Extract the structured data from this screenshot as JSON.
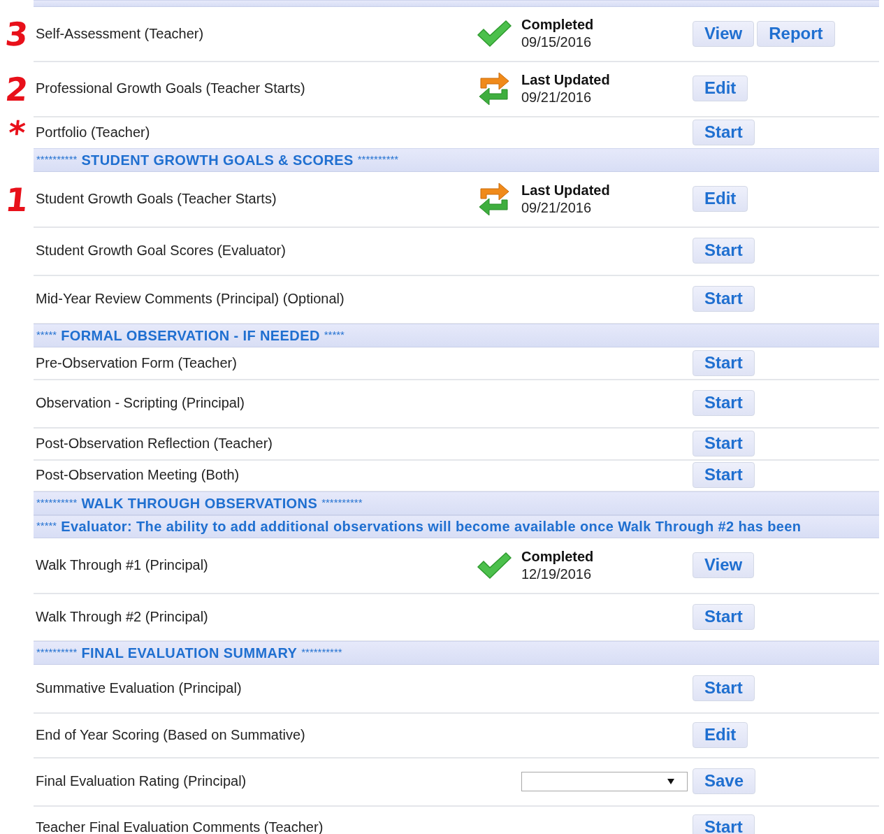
{
  "rows": [
    {
      "kind": "band"
    },
    {
      "kind": "task",
      "annotation": "3",
      "name": "Self-Assessment (Teacher)",
      "status": {
        "kind": "completed",
        "label": "Completed",
        "date": "09/15/2016"
      },
      "buttons": [
        "View",
        "Report"
      ]
    },
    {
      "kind": "task",
      "annotation": "2",
      "name": "Professional Growth Goals (Teacher Starts)",
      "status": {
        "kind": "updated",
        "label": "Last Updated",
        "date": "09/21/2016"
      },
      "buttons": [
        "Edit"
      ]
    },
    {
      "kind": "task",
      "annotation": "*",
      "name": "Portfolio (Teacher)",
      "buttons": [
        "Start"
      ]
    },
    {
      "kind": "section",
      "prefix": "**********",
      "title": "STUDENT GROWTH GOALS & SCORES",
      "suffix": "**********"
    },
    {
      "kind": "task",
      "annotation": "1",
      "name": "Student Growth Goals (Teacher Starts)",
      "status": {
        "kind": "updated",
        "label": "Last Updated",
        "date": "09/21/2016"
      },
      "buttons": [
        "Edit"
      ]
    },
    {
      "kind": "task",
      "name": "Student Growth Goal Scores (Evaluator)",
      "buttons": [
        "Start"
      ]
    },
    {
      "kind": "task",
      "name": "Mid-Year Review Comments (Principal) (Optional)",
      "buttons": [
        "Start"
      ]
    },
    {
      "kind": "section",
      "prefix": "*****",
      "title": "FORMAL OBSERVATION - IF NEEDED",
      "suffix": "*****"
    },
    {
      "kind": "task",
      "name": "Pre-Observation Form (Teacher)",
      "buttons": [
        "Start"
      ]
    },
    {
      "kind": "task",
      "name": "Observation - Scripting (Principal)",
      "buttons": [
        "Start"
      ]
    },
    {
      "kind": "task",
      "name": "Post-Observation Reflection (Teacher)",
      "buttons": [
        "Start"
      ]
    },
    {
      "kind": "task",
      "name": "Post-Observation Meeting (Both)",
      "buttons": [
        "Start"
      ]
    },
    {
      "kind": "section",
      "prefix": "**********",
      "title": "WALK THROUGH OBSERVATIONS",
      "suffix": "**********"
    },
    {
      "kind": "section",
      "prefix": "*****",
      "title": "Evaluator: The ability to add additional observations will become available once Walk Through #2 has been"
    },
    {
      "kind": "task",
      "name": "Walk Through #1 (Principal)",
      "status": {
        "kind": "completed",
        "label": "Completed",
        "date": "12/19/2016"
      },
      "buttons": [
        "View"
      ]
    },
    {
      "kind": "task",
      "name": "Walk Through #2 (Principal)",
      "buttons": [
        "Start"
      ]
    },
    {
      "kind": "section",
      "prefix": "**********",
      "title": "FINAL EVALUATION SUMMARY",
      "suffix": "**********"
    },
    {
      "kind": "task",
      "name": "Summative Evaluation (Principal)",
      "buttons": [
        "Start"
      ]
    },
    {
      "kind": "task",
      "name": "End of Year Scoring (Based on Summative)",
      "buttons": [
        "Edit"
      ]
    },
    {
      "kind": "select_task",
      "name": "Final Evaluation Rating (Principal)",
      "buttons": [
        "Save"
      ]
    },
    {
      "kind": "task",
      "name": "Teacher Final Evaluation Comments (Teacher)",
      "buttons": [
        "Start"
      ]
    }
  ]
}
